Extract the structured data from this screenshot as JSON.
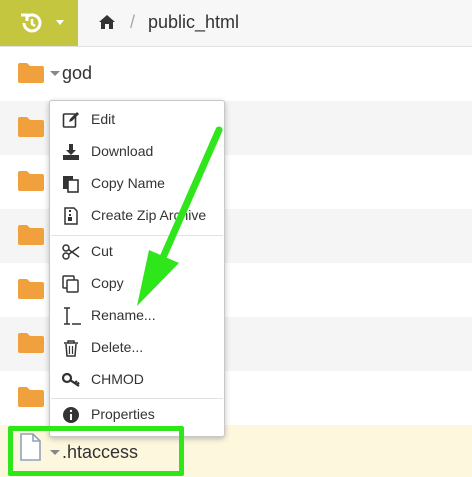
{
  "toolbar": {
    "history_icon": "history-icon",
    "accent": "#c5c63f",
    "breadcrumb": {
      "home_icon": "home-icon",
      "separator": "/",
      "path": "public_html"
    }
  },
  "files": [
    {
      "name": "god",
      "type": "folder"
    },
    {
      "name": "",
      "type": "folder"
    },
    {
      "name": "",
      "type": "folder"
    },
    {
      "name": "",
      "type": "folder"
    },
    {
      "name": "",
      "type": "folder"
    },
    {
      "name": "",
      "type": "folder"
    },
    {
      "name": "",
      "type": "folder"
    },
    {
      "name": ".htaccess",
      "type": "file",
      "selected": true
    }
  ],
  "context_menu": {
    "items": [
      {
        "label": "Edit",
        "icon": "edit-icon"
      },
      {
        "label": "Download",
        "icon": "download-icon"
      },
      {
        "label": "Copy Name",
        "icon": "copy-name-icon"
      },
      {
        "label": "Create Zip Archive",
        "icon": "zip-icon"
      },
      {
        "label": "Cut",
        "icon": "scissors-icon"
      },
      {
        "label": "Copy",
        "icon": "copy-icon"
      },
      {
        "label": "Rename...",
        "icon": "text-cursor-icon"
      },
      {
        "label": "Delete...",
        "icon": "trash-icon"
      },
      {
        "label": "CHMOD",
        "icon": "key-icon"
      },
      {
        "label": "Properties",
        "icon": "info-icon"
      }
    ]
  },
  "annotation": {
    "color": "#2ee61a",
    "arrow_target": "Rename..."
  },
  "folder_color": "#f0a03c"
}
